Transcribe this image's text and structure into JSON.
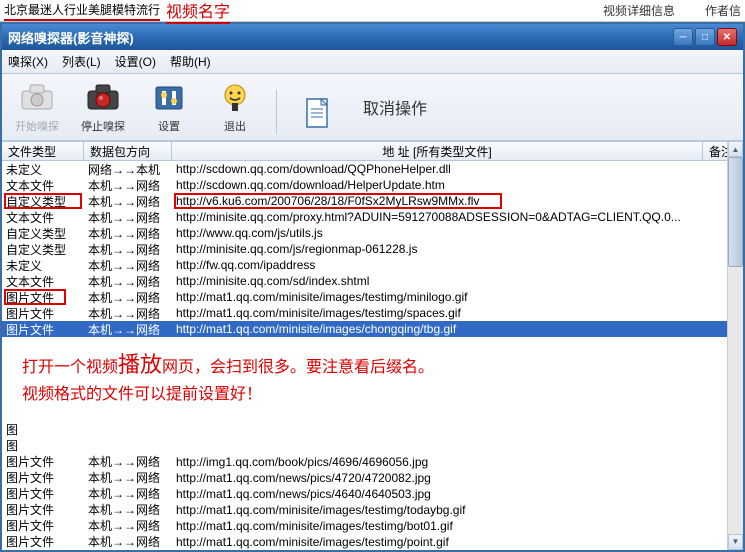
{
  "top": {
    "title": "北京最迷人行业美腿模特流行",
    "anno": "视频名字",
    "right1": "视频详细信息",
    "right2": "作者信"
  },
  "window": {
    "title": "网络嗅探器(影音神探)"
  },
  "menu": {
    "sniff": "嗅探(X)",
    "list": "列表(L)",
    "settings": "设置(O)",
    "help": "帮助(H)"
  },
  "toolbar": {
    "start": "开始嗅探",
    "stop": "停止嗅探",
    "settings": "设置",
    "exit": "退出",
    "cancel_op": "取消操作"
  },
  "columns": {
    "c0": "文件类型",
    "c1": "数据包方向",
    "c2": "地  址  [所有类型文件]",
    "c3": "备注"
  },
  "rows": [
    {
      "t": "未定义",
      "d": "网络→→本机",
      "u": "http://scdown.qq.com/download/QQPhoneHelper.dll"
    },
    {
      "t": "文本文件",
      "d": "本机→→网络",
      "u": "http://scdown.qq.com/download/HelperUpdate.htm"
    },
    {
      "t": "自定义类型",
      "d": "本机→→网络",
      "u": "http://v6.ku6.com/200706/28/18/F0fSx2MyLRsw9MMx.flv"
    },
    {
      "t": "文本文件",
      "d": "本机→→网络",
      "u": "http://minisite.qq.com/proxy.html?ADUIN=591270088ADSESSION=0&ADTAG=CLIENT.QQ.0..."
    },
    {
      "t": "自定义类型",
      "d": "本机→→网络",
      "u": "http://www.qq.com/js/utils.js"
    },
    {
      "t": "自定义类型",
      "d": "本机→→网络",
      "u": "http://minisite.qq.com/js/regionmap-061228.js"
    },
    {
      "t": "未定义",
      "d": "本机→→网络",
      "u": "http://fw.qq.com/ipaddress"
    },
    {
      "t": "文本文件",
      "d": "本机→→网络",
      "u": "http://minisite.qq.com/sd/index.shtml"
    },
    {
      "t": "图片文件",
      "d": "本机→→网络",
      "u": "http://mat1.qq.com/minisite/images/testimg/minilogo.gif"
    },
    {
      "t": "图片文件",
      "d": "本机→→网络",
      "u": "http://mat1.qq.com/minisite/images/testimg/spaces.gif"
    },
    {
      "t": "图片文件",
      "d": "本机→→网络",
      "u": "http://mat1.qq.com/minisite/images/chongqing/tbg.gif"
    }
  ],
  "anno_block": {
    "line1a": "打开一个视频",
    "line1b": "播放",
    "line1c": "网页，会扫到很多。要注意看后缀名。",
    "line2": "视频格式的文件可以提前设置好！"
  },
  "rows2_header": "图",
  "rows2": [
    {
      "t": "图",
      "d": "",
      "u": ""
    },
    {
      "t": "图片文件",
      "d": "本机→→网络",
      "u": "http://img1.qq.com/book/pics/4696/4696056.jpg"
    },
    {
      "t": "图片文件",
      "d": "本机→→网络",
      "u": "http://mat1.qq.com/news/pics/4720/4720082.jpg"
    },
    {
      "t": "图片文件",
      "d": "本机→→网络",
      "u": "http://mat1.qq.com/news/pics/4640/4640503.jpg"
    },
    {
      "t": "图片文件",
      "d": "本机→→网络",
      "u": "http://mat1.qq.com/minisite/images/testimg/todaybg.gif"
    },
    {
      "t": "图片文件",
      "d": "本机→→网络",
      "u": "http://mat1.qq.com/minisite/images/testimg/bot01.gif"
    },
    {
      "t": "图片文件",
      "d": "本机→→网络",
      "u": "http://mat1.qq.com/minisite/images/testimg/point.gif"
    }
  ]
}
